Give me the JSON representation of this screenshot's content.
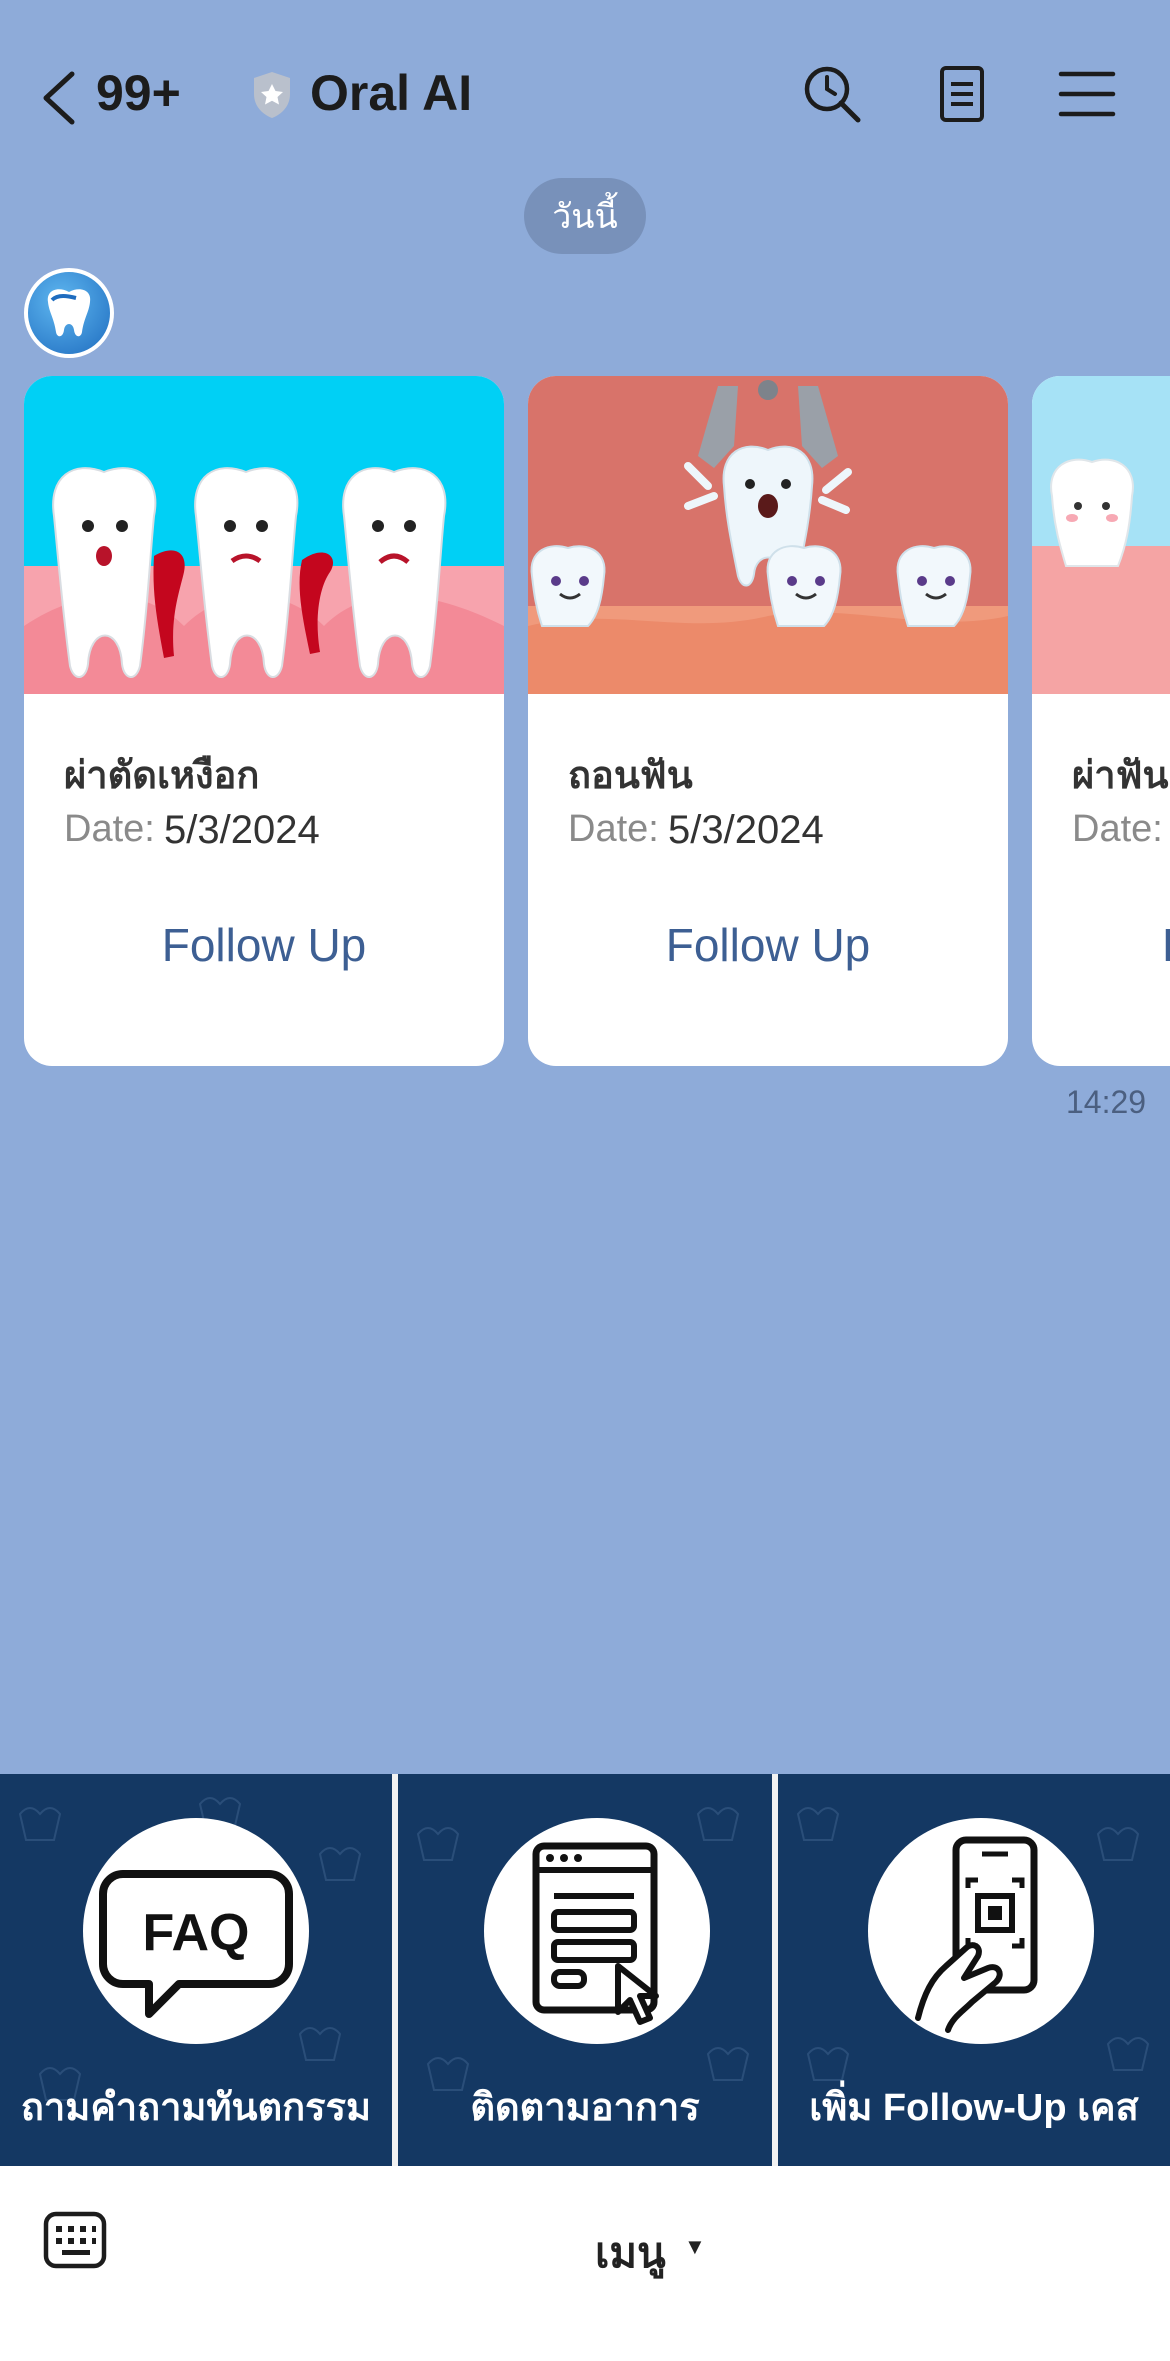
{
  "header": {
    "unread_count": "99+",
    "title": "Oral AI"
  },
  "chat": {
    "date_separator": "วันนี้",
    "timestamp": "14:29",
    "cards": [
      {
        "title": "ผ่าตัดเหงือก",
        "date_label": "Date:",
        "date": "5/3/2024",
        "action": "Follow Up"
      },
      {
        "title": "ถอนฟัน",
        "date_label": "Date:",
        "date": "5/3/2024",
        "action": "Follow Up"
      },
      {
        "title": "ผ่าฟัน",
        "date_label": "Date:",
        "date": "",
        "action": "F"
      }
    ]
  },
  "rich_menu": {
    "items": [
      {
        "label": "ถามคำถามทันตกรรม",
        "icon": "faq-bubble-icon"
      },
      {
        "label": "ติดตามอาการ",
        "icon": "form-cursor-icon"
      },
      {
        "label": "เพิ่ม Follow-Up เคส",
        "icon": "phone-qr-scan-icon"
      }
    ]
  },
  "bottom_bar": {
    "menu_label": "เมนู",
    "caret": "▼"
  },
  "colors": {
    "chat_background": "#8eabd9",
    "rich_menu_tile": "#143863",
    "follow_up_link": "#3d5f93"
  }
}
